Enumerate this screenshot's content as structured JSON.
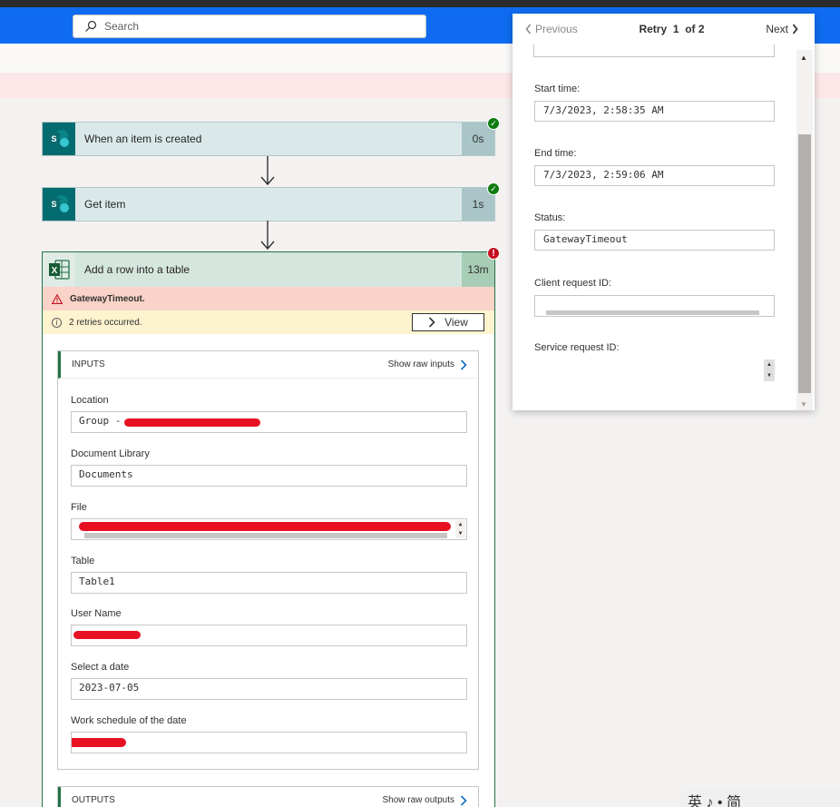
{
  "search": {
    "placeholder": "Search"
  },
  "flow": {
    "steps": [
      {
        "label": "When an item is created",
        "duration": "0s",
        "icon": "S"
      },
      {
        "label": "Get item",
        "duration": "1s",
        "icon": "S"
      }
    ],
    "action": {
      "label": "Add a row into a table",
      "duration": "13m",
      "error": "GatewayTimeout.",
      "retries": "2 retries occurred.",
      "view_label": "View",
      "inputs_title": "INPUTS",
      "show_raw_inputs": "Show raw inputs",
      "outputs_title": "OUTPUTS",
      "show_raw_outputs": "Show raw outputs",
      "fields": [
        {
          "label": "Location",
          "value": "Group - "
        },
        {
          "label": "Document Library",
          "value": "Documents"
        },
        {
          "label": "File",
          "value": ""
        },
        {
          "label": "Table",
          "value": "Table1"
        },
        {
          "label": "User Name",
          "value": ""
        },
        {
          "label": "Select a date",
          "value": "2023-07-05"
        },
        {
          "label": "Work schedule of the date",
          "value": ""
        }
      ]
    }
  },
  "retry_panel": {
    "prev_label": "Previous",
    "retry_label": "Retry",
    "retry_index": "1",
    "retry_total": "of 2",
    "next_label": "Next",
    "fields": [
      {
        "label": "Start time:",
        "value": "7/3/2023, 2:58:35 AM"
      },
      {
        "label": "End time:",
        "value": "7/3/2023, 2:59:06 AM"
      },
      {
        "label": "Status:",
        "value": "GatewayTimeout"
      },
      {
        "label": "Client request ID:",
        "value": ""
      },
      {
        "label": "Service request ID:",
        "value": ""
      }
    ]
  },
  "ime_bar": {
    "text": "英 ♪ • 简"
  }
}
